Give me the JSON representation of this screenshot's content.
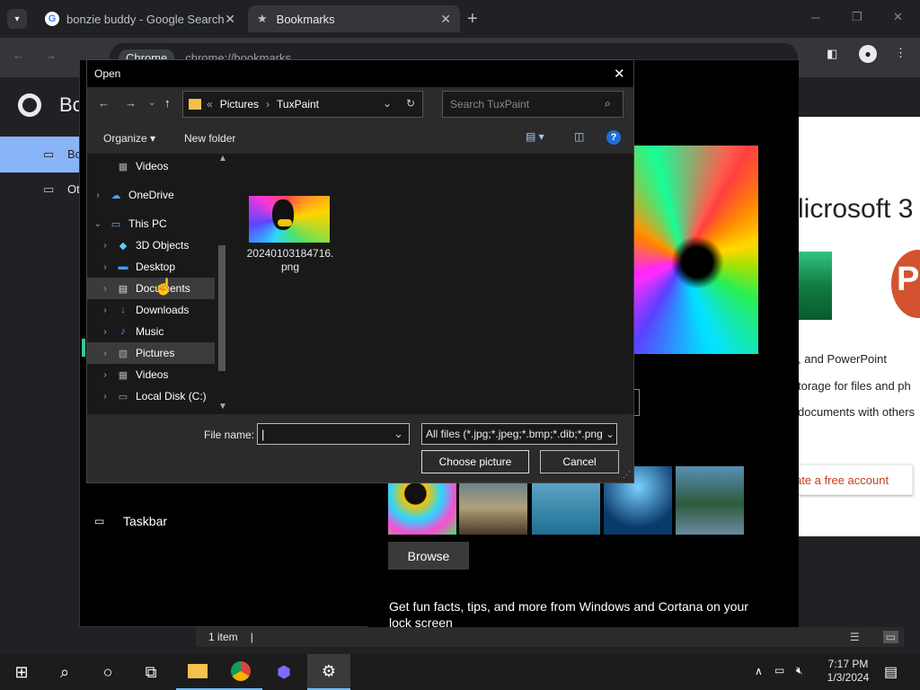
{
  "browser": {
    "tabs": [
      {
        "title": "bonzie buddy - Google Search"
      },
      {
        "title": "Bookmarks"
      }
    ],
    "new_tab": "+",
    "address_chip": "Chrome",
    "address_url": "chrome://bookmarks",
    "page_title": "Bo",
    "sidebar_items": [
      "Bo",
      "Ot"
    ]
  },
  "settings": {
    "ms_heading": "licrosoft 3",
    "ms_lines": [
      ", and PowerPoint",
      "torage for files and ph",
      "documents with others"
    ],
    "ms_button": "ate a free account",
    "taskbar_label": "Taskbar",
    "browse": "Browse",
    "fun_facts": "Get fun facts, tips, and more from Windows and Cortana on your lock screen",
    "status": "1 item"
  },
  "dialog": {
    "title": "Open",
    "path": [
      "Pictures",
      "TuxPaint"
    ],
    "search_placeholder": "Search TuxPaint",
    "organize": "Organize",
    "new_folder": "New folder",
    "nav": [
      {
        "label": "Videos",
        "icon": "video-icon"
      },
      {
        "label": "OneDrive",
        "icon": "cloud-icon"
      },
      {
        "label": "This PC",
        "icon": "computer-icon"
      },
      {
        "label": "3D Objects",
        "icon": "cube-icon"
      },
      {
        "label": "Desktop",
        "icon": "desktop-icon"
      },
      {
        "label": "Documents",
        "icon": "document-icon"
      },
      {
        "label": "Downloads",
        "icon": "download-icon"
      },
      {
        "label": "Music",
        "icon": "music-icon"
      },
      {
        "label": "Pictures",
        "icon": "picture-icon"
      },
      {
        "label": "Videos",
        "icon": "video-icon"
      },
      {
        "label": "Local Disk (C:)",
        "icon": "disk-icon"
      }
    ],
    "file": {
      "name_line1": "20240103184716.",
      "name_line2": "png"
    },
    "file_name_label": "File name:",
    "file_name_value": "",
    "filter": "All files (*.jpg;*.jpeg;*.bmp;*.dib;*.png",
    "choose": "Choose picture",
    "cancel": "Cancel"
  },
  "taskbar": {
    "time": "7:17 PM",
    "date": "1/3/2024"
  }
}
